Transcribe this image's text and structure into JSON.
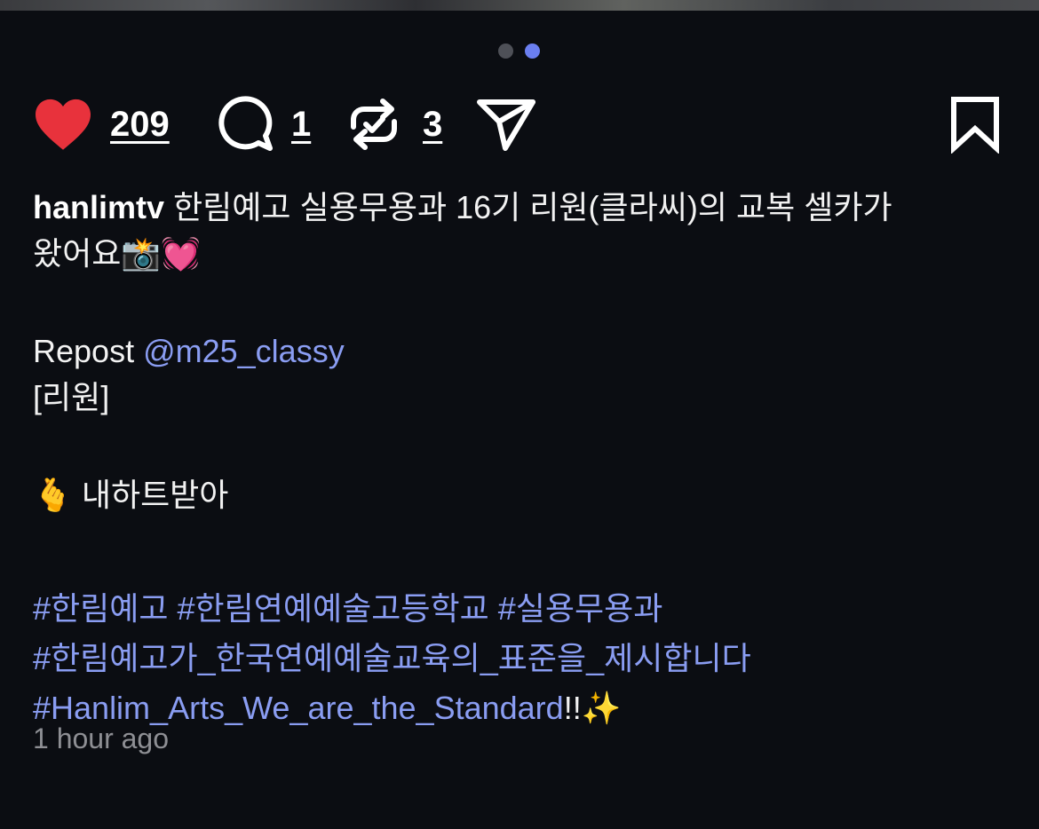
{
  "carousel": {
    "page_count": 2,
    "active_index": 1
  },
  "actions": {
    "like_count": "209",
    "comment_count": "1",
    "repost_count": "3",
    "colors": {
      "like": "#e8323c",
      "icon": "#ffffff"
    },
    "icons": [
      "heart-icon",
      "comment-icon",
      "repost-icon",
      "share-icon",
      "bookmark-icon"
    ]
  },
  "post": {
    "username": "hanlimtv",
    "caption_line1": " 한림예고 실용무용과 16기 리원(클라씨)의 교복 셀카가",
    "caption_line2": "왔어요📸💓",
    "repost_label": "Repost ",
    "repost_mention": "@m25_classy",
    "name_line": "[리원]",
    "heart_line": "🫰 내하트받아",
    "hashtags_line1": [
      "#한림예고",
      "#한림연예예술고등학교",
      "#실용무용과"
    ],
    "hashtag_line2": "#한림예고가_한국연예예술교육의_표준을_제시합니다",
    "hashtag_line3": "#Hanlim_Arts_We_are_the_Standard",
    "line3_suffix": "!!✨",
    "timestamp": "1 hour ago",
    "link_color": "#8a9df2"
  }
}
